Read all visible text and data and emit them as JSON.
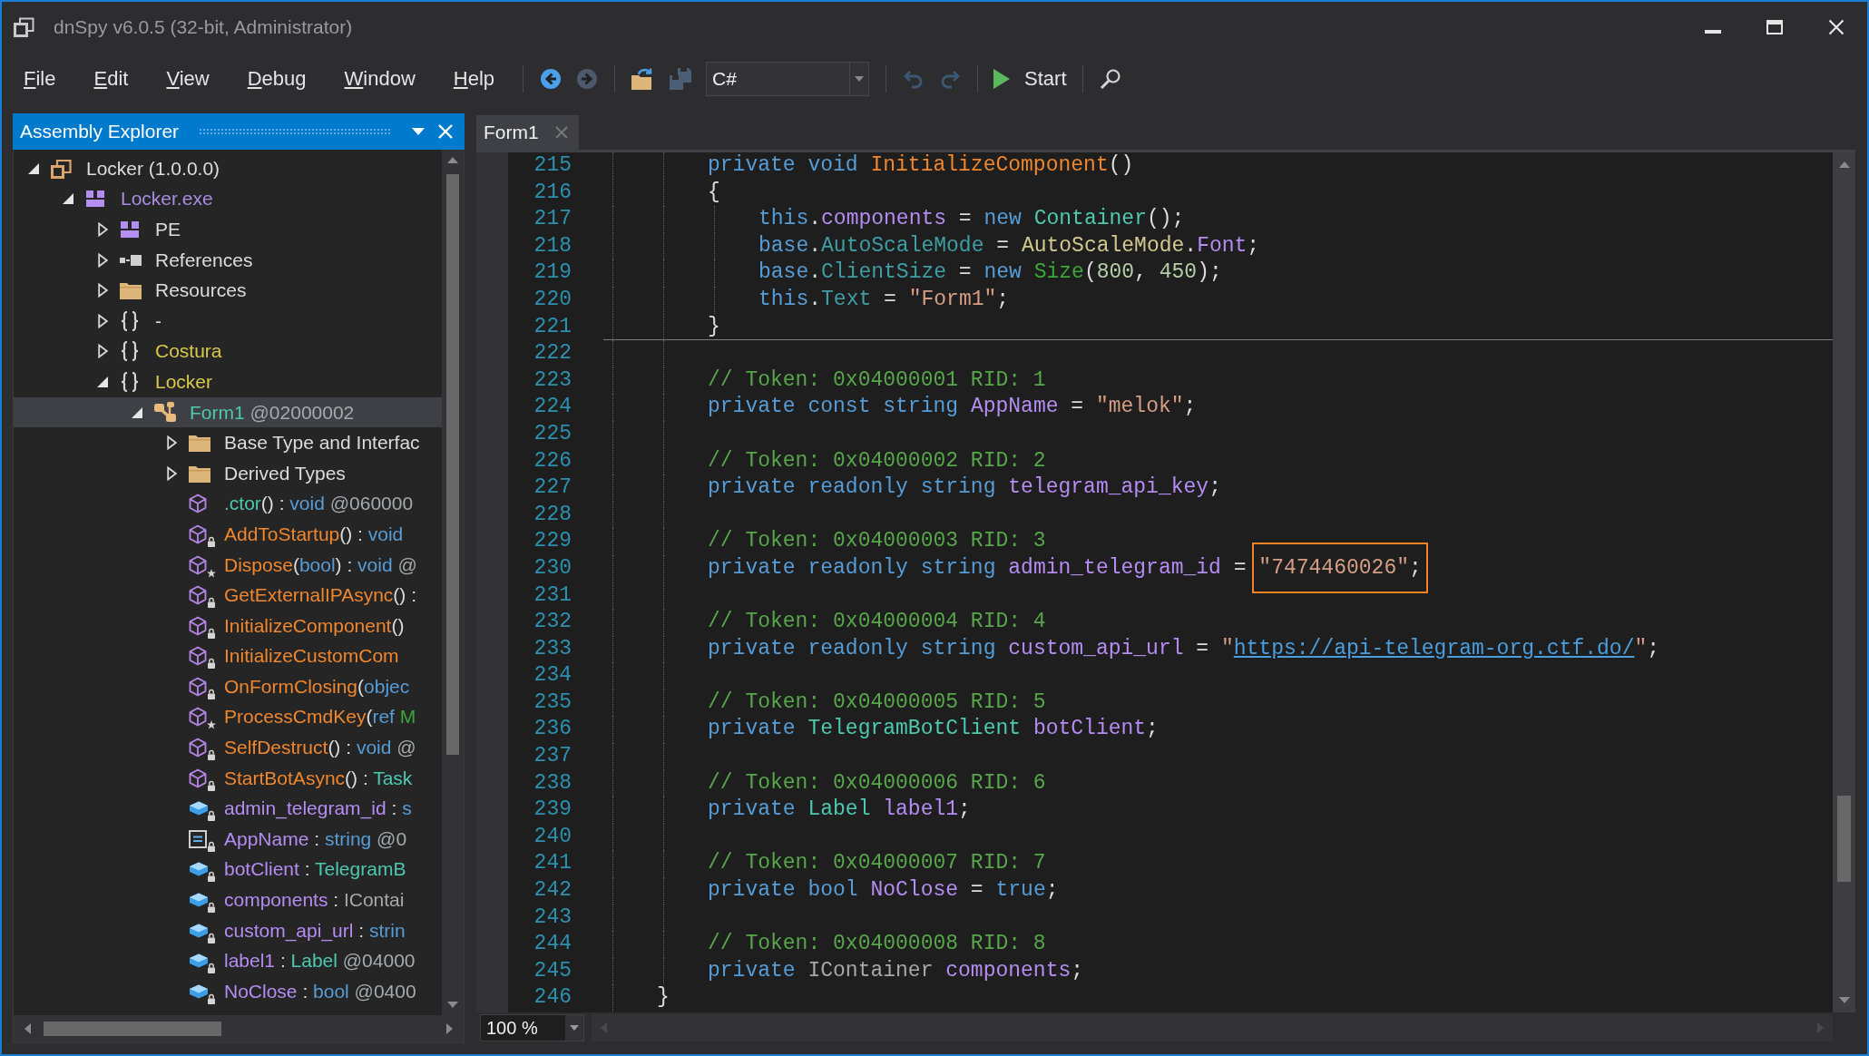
{
  "window": {
    "title": "dnSpy v6.0.5 (32-bit, Administrator)"
  },
  "menu": [
    "File",
    "Edit",
    "View",
    "Debug",
    "Window",
    "Help"
  ],
  "toolbar": [
    {
      "kind": "separator"
    },
    {
      "kind": "back",
      "disabled": false
    },
    {
      "kind": "forward",
      "disabled": true
    },
    {
      "kind": "separator"
    },
    {
      "kind": "open",
      "disabled": false
    },
    {
      "kind": "save",
      "disabled": true
    },
    {
      "kind": "combo",
      "value": "C#"
    },
    {
      "kind": "separator"
    },
    {
      "kind": "undo",
      "disabled": true
    },
    {
      "kind": "redo",
      "disabled": true
    },
    {
      "kind": "separator"
    },
    {
      "kind": "start",
      "label": "Start",
      "disabled": false
    },
    {
      "kind": "separator"
    },
    {
      "kind": "search",
      "disabled": false
    }
  ],
  "explorer": {
    "title": "Assembly Explorer",
    "tree": [
      {
        "kind": "assembly",
        "label": [
          {
            "kind": "plain",
            "text": "Locker (1.0.0.0)"
          }
        ],
        "expanded": true,
        "selected": false,
        "children": [
          {
            "kind": "module",
            "label": [
              {
                "kind": "module",
                "text": "Locker.exe"
              }
            ],
            "expanded": true,
            "selected": false,
            "children": [
              {
                "kind": "pe",
                "label": [
                  {
                    "kind": "plain",
                    "text": "PE"
                  }
                ],
                "expanded": false,
                "selected": false
              },
              {
                "kind": "references",
                "label": [
                  {
                    "kind": "plain",
                    "text": "References"
                  }
                ],
                "expanded": false,
                "selected": false
              },
              {
                "kind": "folder",
                "label": [
                  {
                    "kind": "plain",
                    "text": "Resources"
                  }
                ],
                "expanded": false,
                "selected": false
              },
              {
                "kind": "namespace",
                "label": [
                  {
                    "kind": "plain",
                    "text": "-"
                  }
                ],
                "expanded": false,
                "selected": false
              },
              {
                "kind": "namespace",
                "label": [
                  {
                    "kind": "namespace",
                    "text": "Costura"
                  }
                ],
                "expanded": false,
                "selected": false
              },
              {
                "kind": "namespace",
                "label": [
                  {
                    "kind": "namespace",
                    "text": "Locker"
                  }
                ],
                "expanded": true,
                "selected": false,
                "children": [
                  {
                    "kind": "class",
                    "label": [
                      {
                        "kind": "class",
                        "text": "Form1"
                      },
                      {
                        "kind": "token",
                        "text": " @02000002"
                      }
                    ],
                    "expanded": true,
                    "selected": true,
                    "children": [
                      {
                        "kind": "folder",
                        "label": [
                          {
                            "kind": "plain",
                            "text": "Base Type and Interfac"
                          }
                        ],
                        "expanded": false,
                        "selected": false
                      },
                      {
                        "kind": "folder",
                        "label": [
                          {
                            "kind": "plain",
                            "text": "Derived Types"
                          }
                        ],
                        "expanded": false,
                        "selected": false
                      },
                      {
                        "kind": "method",
                        "private": false,
                        "protected": false,
                        "label": [
                          {
                            "kind": "class",
                            "text": ".ctor"
                          },
                          {
                            "kind": "plain",
                            "text": "() : "
                          },
                          {
                            "kind": "keyword",
                            "text": "void"
                          },
                          {
                            "kind": "token",
                            "text": " @060000"
                          }
                        ],
                        "selected": false
                      },
                      {
                        "kind": "method",
                        "private": true,
                        "protected": false,
                        "label": [
                          {
                            "kind": "method",
                            "text": "AddToStartup"
                          },
                          {
                            "kind": "plain",
                            "text": "() : "
                          },
                          {
                            "kind": "keyword",
                            "text": "void"
                          }
                        ],
                        "selected": false
                      },
                      {
                        "kind": "method",
                        "private": false,
                        "protected": true,
                        "label": [
                          {
                            "kind": "method",
                            "text": "Dispose"
                          },
                          {
                            "kind": "plain",
                            "text": "("
                          },
                          {
                            "kind": "keyword",
                            "text": "bool"
                          },
                          {
                            "kind": "plain",
                            "text": ") : "
                          },
                          {
                            "kind": "keyword",
                            "text": "void"
                          },
                          {
                            "kind": "token",
                            "text": " @"
                          }
                        ],
                        "selected": false
                      },
                      {
                        "kind": "method",
                        "private": true,
                        "protected": false,
                        "label": [
                          {
                            "kind": "method",
                            "text": "GetExternalIPAsync"
                          },
                          {
                            "kind": "plain",
                            "text": "() :"
                          }
                        ],
                        "selected": false
                      },
                      {
                        "kind": "method",
                        "private": true,
                        "protected": false,
                        "label": [
                          {
                            "kind": "method",
                            "text": "InitializeComponent"
                          },
                          {
                            "kind": "plain",
                            "text": "()"
                          }
                        ],
                        "selected": false
                      },
                      {
                        "kind": "method",
                        "private": true,
                        "protected": false,
                        "label": [
                          {
                            "kind": "method",
                            "text": "InitializeCustomCom"
                          }
                        ],
                        "selected": false
                      },
                      {
                        "kind": "method",
                        "private": true,
                        "protected": false,
                        "label": [
                          {
                            "kind": "method",
                            "text": "OnFormClosing"
                          },
                          {
                            "kind": "plain",
                            "text": "("
                          },
                          {
                            "kind": "keyword",
                            "text": "objec"
                          }
                        ],
                        "selected": false
                      },
                      {
                        "kind": "method",
                        "private": false,
                        "protected": true,
                        "label": [
                          {
                            "kind": "method",
                            "text": "ProcessCmdKey"
                          },
                          {
                            "kind": "plain",
                            "text": "("
                          },
                          {
                            "kind": "keyword",
                            "text": "ref"
                          },
                          {
                            "kind": "struct",
                            "text": " M"
                          }
                        ],
                        "selected": false
                      },
                      {
                        "kind": "method",
                        "private": true,
                        "protected": false,
                        "label": [
                          {
                            "kind": "method",
                            "text": "SelfDestruct"
                          },
                          {
                            "kind": "plain",
                            "text": "() : "
                          },
                          {
                            "kind": "keyword",
                            "text": "void"
                          },
                          {
                            "kind": "token",
                            "text": " @"
                          }
                        ],
                        "selected": false
                      },
                      {
                        "kind": "method",
                        "private": true,
                        "protected": false,
                        "label": [
                          {
                            "kind": "method",
                            "text": "StartBotAsync"
                          },
                          {
                            "kind": "plain",
                            "text": "() : "
                          },
                          {
                            "kind": "class",
                            "text": "Task"
                          }
                        ],
                        "selected": false
                      },
                      {
                        "kind": "field",
                        "private": true,
                        "protected": false,
                        "label": [
                          {
                            "kind": "field",
                            "text": "admin_telegram_id"
                          },
                          {
                            "kind": "plain",
                            "text": " : "
                          },
                          {
                            "kind": "keyword",
                            "text": "s"
                          }
                        ],
                        "selected": false
                      },
                      {
                        "kind": "constant",
                        "private": true,
                        "protected": false,
                        "label": [
                          {
                            "kind": "field",
                            "text": "AppName"
                          },
                          {
                            "kind": "plain",
                            "text": " : "
                          },
                          {
                            "kind": "keyword",
                            "text": "string"
                          },
                          {
                            "kind": "token",
                            "text": " @0"
                          }
                        ],
                        "selected": false
                      },
                      {
                        "kind": "field",
                        "private": true,
                        "protected": false,
                        "label": [
                          {
                            "kind": "field",
                            "text": "botClient"
                          },
                          {
                            "kind": "plain",
                            "text": " : "
                          },
                          {
                            "kind": "class",
                            "text": "TelegramB"
                          }
                        ],
                        "selected": false
                      },
                      {
                        "kind": "field",
                        "private": true,
                        "protected": false,
                        "label": [
                          {
                            "kind": "field",
                            "text": "components"
                          },
                          {
                            "kind": "plain",
                            "text": " : "
                          },
                          {
                            "kind": "interface",
                            "text": "IContai"
                          }
                        ],
                        "selected": false
                      },
                      {
                        "kind": "field",
                        "private": true,
                        "protected": false,
                        "label": [
                          {
                            "kind": "field",
                            "text": "custom_api_url"
                          },
                          {
                            "kind": "plain",
                            "text": " : "
                          },
                          {
                            "kind": "keyword",
                            "text": "strin"
                          }
                        ],
                        "selected": false
                      },
                      {
                        "kind": "field",
                        "private": true,
                        "protected": false,
                        "label": [
                          {
                            "kind": "field",
                            "text": "label1"
                          },
                          {
                            "kind": "plain",
                            "text": " : "
                          },
                          {
                            "kind": "class",
                            "text": "Label"
                          },
                          {
                            "kind": "token",
                            "text": " @04000"
                          }
                        ],
                        "selected": false
                      },
                      {
                        "kind": "field",
                        "private": true,
                        "protected": false,
                        "label": [
                          {
                            "kind": "field",
                            "text": "NoClose"
                          },
                          {
                            "kind": "plain",
                            "text": " : "
                          },
                          {
                            "kind": "keyword",
                            "text": "bool"
                          },
                          {
                            "kind": "token",
                            "text": " @0400"
                          }
                        ],
                        "selected": false
                      }
                    ]
                  }
                ]
              }
            ]
          }
        ]
      }
    ]
  },
  "editor": {
    "tabs": [
      {
        "label": "Form1",
        "selected": true
      }
    ],
    "lines": [
      {
        "children": [
          {
            "number": "215",
            "tokens": [
              {
                "kind": "keyword",
                "text": "private"
              },
              {
                "kind": "keyword",
                "text": " void"
              },
              {
                "kind": "method",
                "text": " InitializeComponent"
              },
              {
                "kind": "plain",
                "text": "()"
              }
            ]
          },
          {
            "number": "216",
            "tokens": [
              {
                "kind": "plain",
                "text": "{"
              }
            ]
          },
          {
            "children": [
              {
                "number": "217",
                "tokens": [
                  {
                    "kind": "keyword",
                    "text": "this"
                  },
                  {
                    "kind": "plain",
                    "text": "."
                  },
                  {
                    "kind": "field",
                    "text": "components"
                  },
                  {
                    "kind": "plain",
                    "text": " = "
                  },
                  {
                    "kind": "keyword",
                    "text": "new"
                  },
                  {
                    "kind": "class",
                    "text": " Container"
                  },
                  {
                    "kind": "plain",
                    "text": "();"
                  }
                ]
              },
              {
                "number": "218",
                "tokens": [
                  {
                    "kind": "keyword",
                    "text": "base"
                  },
                  {
                    "kind": "plain",
                    "text": "."
                  },
                  {
                    "kind": "property",
                    "text": "AutoScaleMode"
                  },
                  {
                    "kind": "plain",
                    "text": " = "
                  },
                  {
                    "kind": "enum",
                    "text": "AutoScaleMode"
                  },
                  {
                    "kind": "plain",
                    "text": "."
                  },
                  {
                    "kind": "field",
                    "text": "Font"
                  },
                  {
                    "kind": "plain",
                    "text": ";"
                  }
                ]
              },
              {
                "number": "219",
                "tokens": [
                  {
                    "kind": "keyword",
                    "text": "base"
                  },
                  {
                    "kind": "plain",
                    "text": "."
                  },
                  {
                    "kind": "property",
                    "text": "ClientSize"
                  },
                  {
                    "kind": "plain",
                    "text": " = "
                  },
                  {
                    "kind": "keyword",
                    "text": "new"
                  },
                  {
                    "kind": "struct",
                    "text": " Size"
                  },
                  {
                    "kind": "plain",
                    "text": "("
                  },
                  {
                    "kind": "number",
                    "text": "800"
                  },
                  {
                    "kind": "plain",
                    "text": ", "
                  },
                  {
                    "kind": "number",
                    "text": "450"
                  },
                  {
                    "kind": "plain",
                    "text": ");"
                  }
                ]
              },
              {
                "number": "220",
                "tokens": [
                  {
                    "kind": "keyword",
                    "text": "this"
                  },
                  {
                    "kind": "plain",
                    "text": "."
                  },
                  {
                    "kind": "property",
                    "text": "Text"
                  },
                  {
                    "kind": "plain",
                    "text": " = "
                  },
                  {
                    "kind": "string",
                    "text": "\"Form1\""
                  },
                  {
                    "kind": "plain",
                    "text": ";"
                  }
                ]
              }
            ]
          },
          {
            "number": "221",
            "tokens": [
              {
                "kind": "plain",
                "text": "}"
              }
            ],
            "separator": true
          },
          {
            "number": "222"
          },
          {
            "number": "223",
            "tokens": [
              {
                "kind": "comment",
                "text": "// Token: 0x04000001 RID: 1"
              }
            ]
          },
          {
            "number": "224",
            "tokens": [
              {
                "kind": "keyword",
                "text": "private"
              },
              {
                "kind": "keyword",
                "text": " const"
              },
              {
                "kind": "keyword",
                "text": " string"
              },
              {
                "kind": "field",
                "text": " AppName"
              },
              {
                "kind": "plain",
                "text": " = "
              },
              {
                "kind": "string",
                "text": "\"melok\""
              },
              {
                "kind": "plain",
                "text": ";"
              }
            ]
          },
          {
            "number": "225"
          },
          {
            "number": "226",
            "tokens": [
              {
                "kind": "comment",
                "text": "// Token: 0x04000002 RID: 2"
              }
            ]
          },
          {
            "number": "227",
            "tokens": [
              {
                "kind": "keyword",
                "text": "private"
              },
              {
                "kind": "keyword",
                "text": " readonly"
              },
              {
                "kind": "keyword",
                "text": " string"
              },
              {
                "kind": "field",
                "text": " telegram_api_key"
              },
              {
                "kind": "plain",
                "text": ";"
              }
            ]
          },
          {
            "number": "228"
          },
          {
            "number": "229",
            "tokens": [
              {
                "kind": "comment",
                "text": "// Token: 0x04000003 RID: 3"
              }
            ]
          },
          {
            "number": "230",
            "tokens": [
              {
                "kind": "keyword",
                "text": "private"
              },
              {
                "kind": "keyword",
                "text": " readonly"
              },
              {
                "kind": "keyword",
                "text": " string"
              },
              {
                "kind": "field",
                "text": " admin_telegram_id"
              },
              {
                "kind": "plain",
                "text": " = "
              }
            ],
            "highlight": [
              {
                "kind": "string",
                "text": "\"7474460026\""
              },
              {
                "kind": "plain",
                "text": ";"
              }
            ]
          },
          {
            "number": "231"
          },
          {
            "number": "232",
            "tokens": [
              {
                "kind": "comment",
                "text": "// Token: 0x04000004 RID: 4"
              }
            ]
          },
          {
            "number": "233",
            "tokens": [
              {
                "kind": "keyword",
                "text": "private"
              },
              {
                "kind": "keyword",
                "text": " readonly"
              },
              {
                "kind": "keyword",
                "text": " string"
              },
              {
                "kind": "field",
                "text": " custom_api_url"
              },
              {
                "kind": "plain",
                "text": " = "
              },
              {
                "kind": "string",
                "text": "\""
              },
              {
                "kind": "link",
                "text": "https://api-telegram-org.ctf.do/"
              },
              {
                "kind": "string",
                "text": "\""
              },
              {
                "kind": "plain",
                "text": ";"
              }
            ]
          },
          {
            "number": "234"
          },
          {
            "number": "235",
            "tokens": [
              {
                "kind": "comment",
                "text": "// Token: 0x04000005 RID: 5"
              }
            ]
          },
          {
            "number": "236",
            "tokens": [
              {
                "kind": "keyword",
                "text": "private"
              },
              {
                "kind": "class",
                "text": " TelegramBotClient"
              },
              {
                "kind": "field",
                "text": " botClient"
              },
              {
                "kind": "plain",
                "text": ";"
              }
            ]
          },
          {
            "number": "237"
          },
          {
            "number": "238",
            "tokens": [
              {
                "kind": "comment",
                "text": "// Token: 0x04000006 RID: 6"
              }
            ]
          },
          {
            "number": "239",
            "tokens": [
              {
                "kind": "keyword",
                "text": "private"
              },
              {
                "kind": "class",
                "text": " Label"
              },
              {
                "kind": "field",
                "text": " label1"
              },
              {
                "kind": "plain",
                "text": ";"
              }
            ]
          },
          {
            "number": "240"
          },
          {
            "number": "241",
            "tokens": [
              {
                "kind": "comment",
                "text": "// Token: 0x04000007 RID: 7"
              }
            ]
          },
          {
            "number": "242",
            "tokens": [
              {
                "kind": "keyword",
                "text": "private"
              },
              {
                "kind": "keyword",
                "text": " bool"
              },
              {
                "kind": "field",
                "text": " NoClose"
              },
              {
                "kind": "plain",
                "text": " = "
              },
              {
                "kind": "keyword",
                "text": "true"
              },
              {
                "kind": "plain",
                "text": ";"
              }
            ]
          },
          {
            "number": "243"
          },
          {
            "number": "244",
            "tokens": [
              {
                "kind": "comment",
                "text": "// Token: 0x04000008 RID: 8"
              }
            ]
          },
          {
            "number": "245",
            "tokens": [
              {
                "kind": "keyword",
                "text": "private"
              },
              {
                "kind": "interface",
                "text": " IContainer"
              },
              {
                "kind": "field",
                "text": " components"
              },
              {
                "kind": "plain",
                "text": ";"
              }
            ]
          }
        ]
      },
      {
        "number": "246",
        "tokens": [
          {
            "kind": "plain",
            "text": "}"
          }
        ]
      }
    ],
    "zoom": {
      "value": "100 %"
    }
  }
}
